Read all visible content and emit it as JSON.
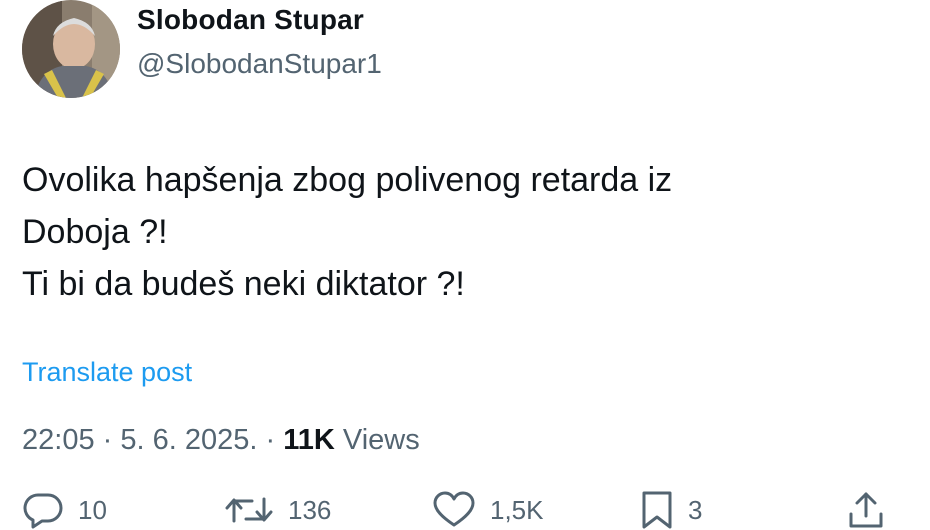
{
  "author": {
    "display_name": "Slobodan Stupar",
    "handle": "@SlobodanStupar1"
  },
  "tweet": {
    "lines": [
      "Ovolika hapšenja zbog polivenog retarda iz",
      "Doboja ?!",
      "Ti bi da budeš neki diktator ?!"
    ]
  },
  "translate_label": "Translate post",
  "meta": {
    "time": "22:05",
    "separator": " · ",
    "date": "5. 6. 2025.",
    "views_count": "11K",
    "views_label": " Views"
  },
  "actions": {
    "reply": {
      "icon": "reply-icon",
      "count": "10"
    },
    "repost": {
      "icon": "repost-icon",
      "count": "136"
    },
    "like": {
      "icon": "heart-icon",
      "count": "1,5K"
    },
    "bookmark": {
      "icon": "bookmark-icon",
      "count": "3"
    },
    "share": {
      "icon": "share-icon"
    }
  },
  "colors": {
    "link": "#1d9bf0",
    "text": "#0f1419",
    "secondary": "#536471",
    "avatar_scarf": "#d9c24a"
  }
}
